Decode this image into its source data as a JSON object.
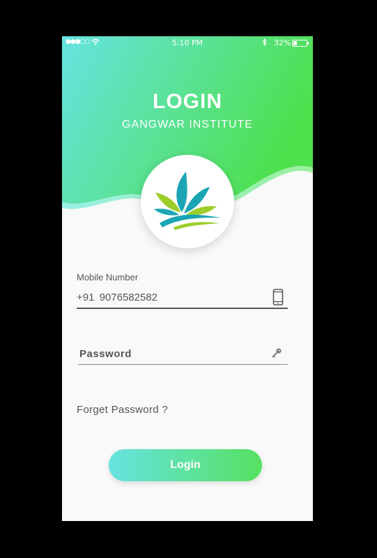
{
  "status_bar": {
    "signal": "●●●○○",
    "time": "5:10 PM",
    "battery": "32%"
  },
  "header": {
    "title": "LOGIN",
    "subtitle": "GANGWAR INSTITUTE"
  },
  "form": {
    "mobile_label": "Mobile Number",
    "mobile_value": "+91  9076582582",
    "password_placeholder": "Password",
    "forget_password": "Forget Password ?",
    "login_button": "Login"
  },
  "colors": {
    "gradient_start": "#66e3e2",
    "gradient_end": "#4fe04e",
    "background": "#f9f9f9",
    "logo_teal": "#1ba5b4",
    "logo_green": "#9ccc2a"
  }
}
